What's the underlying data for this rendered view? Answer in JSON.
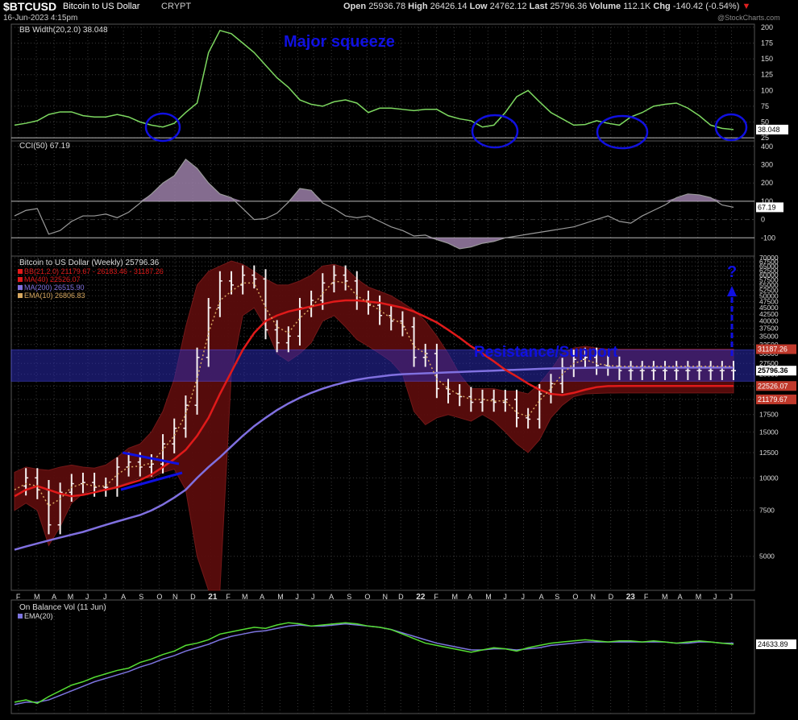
{
  "header": {
    "symbol": "$BTCUSD",
    "name": "Bitcoin to US Dollar",
    "exchange": "CRYPT",
    "datetime": "16-Jun-2023 4:15pm",
    "open_label": "Open",
    "open": "25936.78",
    "high_label": "High",
    "high": "26426.14",
    "low_label": "Low",
    "low": "24762.12",
    "last_label": "Last",
    "last": "25796.36",
    "volume_label": "Volume",
    "volume": "112.1K",
    "chg_label": "Chg",
    "chg": "-140.42 (-0.54%)",
    "arrow": "▼",
    "watermark": "@StockCharts.com"
  },
  "colors": {
    "background": "#000000",
    "grid": "#3a3a3a",
    "bb_width_line": "#7dd860",
    "cci_line": "#9a9a9a",
    "cci_fill": "#9b7fa8",
    "bb_band_fill": "#5a0c0c",
    "ma40": "#e01a1a",
    "ma200": "#8070e0",
    "ema10": "#d8a860",
    "candle": "#f5f0f0",
    "obv": "#55dd33",
    "obv_ema": "#7d75e0",
    "annotation": "#1010e0",
    "band_zone": "#2a2ab0"
  },
  "chart_data": [
    {
      "type": "line",
      "panel": "BB Width",
      "legend": "BB Width(20,2.0) 38.048",
      "annotation": "Major squeeze",
      "last_value_label": "38.048",
      "y_ticks": [
        25,
        50,
        75,
        100,
        125,
        150,
        175,
        200
      ],
      "ylim": [
        20,
        205
      ],
      "x": [
        0,
        3,
        6,
        9,
        12,
        15,
        18,
        21,
        24,
        27,
        30,
        33,
        36,
        39,
        42,
        45,
        48,
        51,
        54,
        57,
        60,
        63,
        66,
        69,
        72,
        75,
        78,
        81,
        84,
        87,
        90,
        93,
        96,
        99,
        102,
        105,
        108,
        111,
        114,
        117,
        120,
        123,
        126,
        129,
        132,
        135,
        138,
        141,
        144,
        147,
        150,
        153,
        156,
        159,
        162,
        165,
        168,
        171,
        174,
        177,
        180,
        183,
        186,
        189
      ],
      "values": [
        45,
        48,
        52,
        62,
        66,
        66,
        60,
        58,
        58,
        62,
        58,
        50,
        45,
        42,
        48,
        65,
        80,
        160,
        195,
        190,
        175,
        160,
        140,
        120,
        105,
        85,
        78,
        75,
        82,
        85,
        80,
        65,
        72,
        72,
        70,
        68,
        70,
        70,
        60,
        55,
        52,
        42,
        45,
        65,
        90,
        100,
        82,
        65,
        55,
        45,
        46,
        52,
        48,
        45,
        58,
        65,
        75,
        78,
        80,
        72,
        60,
        45,
        40,
        38
      ]
    },
    {
      "type": "area",
      "panel": "CCI",
      "legend": "CCI(50) 67.19",
      "last_value_label": "67.19",
      "y_ticks": [
        -100,
        0,
        100,
        200,
        300,
        400
      ],
      "ylim": [
        -200,
        430
      ],
      "x": [
        0,
        3,
        6,
        9,
        12,
        15,
        18,
        21,
        24,
        27,
        30,
        33,
        36,
        39,
        42,
        45,
        48,
        51,
        54,
        57,
        60,
        63,
        66,
        69,
        72,
        75,
        78,
        81,
        84,
        87,
        90,
        93,
        96,
        99,
        102,
        105,
        108,
        111,
        114,
        117,
        120,
        123,
        126,
        129,
        132,
        135,
        138,
        141,
        144,
        147,
        150,
        153,
        156,
        159,
        162,
        165,
        168,
        171,
        174,
        177,
        180,
        183,
        186,
        189
      ],
      "values": [
        20,
        50,
        60,
        -80,
        -60,
        -10,
        20,
        20,
        30,
        10,
        40,
        90,
        140,
        200,
        240,
        330,
        280,
        200,
        140,
        120,
        60,
        0,
        5,
        35,
        95,
        170,
        160,
        90,
        60,
        20,
        10,
        20,
        -10,
        -40,
        -60,
        -90,
        -85,
        -110,
        -130,
        -160,
        -150,
        -130,
        -120,
        -100,
        -90,
        -80,
        -70,
        -60,
        -50,
        -40,
        -20,
        0,
        20,
        -10,
        -20,
        20,
        50,
        80,
        120,
        140,
        135,
        120,
        80,
        67
      ]
    },
    {
      "type": "candlestick",
      "panel": "Price",
      "title": "Bitcoin to US Dollar (Weekly) 25796.36",
      "legend": [
        "BB(21,2.0) 21179.67 - 26183.46 - 31187.26",
        "MA(40) 22526.07",
        "MA(200) 26515.90",
        "EMA(10) 26806.83"
      ],
      "annotations": [
        "Resistance/Support",
        "?"
      ],
      "scale": "log",
      "ylim": [
        3700,
        71000
      ],
      "y_ticks": [
        5000,
        7500,
        10000,
        12500,
        15000,
        17500,
        20000,
        22500,
        25000,
        27500,
        30000,
        32500,
        35000,
        37500,
        40000,
        42500,
        45000,
        47500,
        50000,
        52500,
        55000,
        57500,
        60000,
        62500,
        65000,
        67500,
        70000
      ],
      "price_labels": [
        "31187.26",
        "25796.36",
        "22526.07",
        "21179.67"
      ],
      "support_zone": [
        23500,
        31000
      ],
      "x_labels": [
        "F",
        "M",
        "A",
        "M",
        "J",
        "J",
        "A",
        "S",
        "O",
        "N",
        "D",
        "21",
        "F",
        "M",
        "A",
        "M",
        "J",
        "J",
        "A",
        "S",
        "O",
        "N",
        "D",
        "22",
        "F",
        "M",
        "A",
        "M",
        "J",
        "J",
        "A",
        "S",
        "O",
        "N",
        "D",
        "23",
        "F",
        "M",
        "A",
        "M",
        "J",
        "J"
      ],
      "x_label_positions": [
        1,
        5.5,
        10,
        14,
        18.5,
        23,
        27.5,
        32,
        36.5,
        40.5,
        45,
        49.5,
        54,
        58,
        62.5,
        67,
        71.5,
        75.5,
        80,
        84.5,
        89,
        93.5,
        97.5,
        102,
        106.5,
        111,
        115,
        119.5,
        124,
        128.5,
        133,
        137,
        141.5,
        146,
        150.5,
        155,
        159.5,
        164,
        168,
        172.5,
        177,
        181
      ],
      "x": [
        0,
        3,
        6,
        9,
        12,
        15,
        18,
        21,
        24,
        27,
        30,
        33,
        36,
        39,
        42,
        45,
        48,
        51,
        54,
        57,
        60,
        63,
        66,
        69,
        72,
        75,
        78,
        81,
        84,
        87,
        90,
        93,
        96,
        99,
        102,
        105,
        108,
        111,
        114,
        117,
        120,
        123,
        126,
        129,
        132,
        135,
        138,
        141,
        144,
        147,
        150,
        153,
        156,
        159,
        162,
        165,
        168,
        171,
        174,
        177,
        180,
        183,
        186,
        189
      ],
      "close": [
        9300,
        10000,
        9000,
        6600,
        8800,
        9500,
        9600,
        9200,
        9200,
        11000,
        11500,
        11000,
        11300,
        13500,
        15500,
        19000,
        29000,
        45000,
        57000,
        55000,
        60000,
        58000,
        37000,
        33000,
        35000,
        45000,
        48000,
        56000,
        60000,
        57000,
        48000,
        46000,
        42000,
        40000,
        38000,
        29000,
        30000,
        22000,
        21000,
        20500,
        19500,
        20000,
        19500,
        20000,
        17000,
        16800,
        21000,
        23000,
        26500,
        28500,
        29000,
        27000,
        26800,
        25796,
        25796,
        25796,
        25796,
        25796,
        25796,
        25796,
        25796,
        25796,
        25796,
        25796
      ],
      "bb_upper": [
        10500,
        11000,
        10800,
        10700,
        11000,
        11200,
        11000,
        10900,
        11200,
        12000,
        13000,
        13500,
        15000,
        18000,
        24000,
        38000,
        55000,
        62000,
        65000,
        68000,
        66000,
        62000,
        58000,
        55000,
        55000,
        57000,
        60000,
        65000,
        66000,
        64000,
        58000,
        54000,
        52000,
        50000,
        47000,
        44000,
        40000,
        35000,
        30000,
        25000,
        22000,
        22000,
        22000,
        21500,
        21500,
        21000,
        23000,
        26000,
        30000,
        31500,
        32000,
        31500,
        31200,
        31187,
        31187,
        31187,
        31187,
        31187,
        31187,
        31187,
        31187,
        31187,
        31187,
        31187
      ],
      "bb_lower": [
        7500,
        8000,
        7500,
        5500,
        6500,
        8000,
        8700,
        9000,
        9000,
        9300,
        9600,
        10000,
        10000,
        10500,
        10800,
        9000,
        5000,
        3700,
        3700,
        25000,
        42000,
        45000,
        38000,
        30000,
        28000,
        30000,
        33000,
        40000,
        42000,
        38000,
        34000,
        32000,
        30000,
        28000,
        25000,
        18000,
        16000,
        17000,
        17500,
        17000,
        16500,
        17500,
        16500,
        15000,
        13500,
        12500,
        14000,
        17000,
        19000,
        20500,
        21000,
        21100,
        21170,
        21179,
        21179,
        21179,
        21179,
        21179,
        21179,
        21179,
        21179,
        21179,
        21179,
        21179
      ],
      "ma40": [
        8500,
        9000,
        9300,
        9000,
        8700,
        8500,
        8600,
        8800,
        9000,
        9200,
        9500,
        9800,
        10300,
        11000,
        11800,
        12800,
        14500,
        17000,
        21000,
        25500,
        31000,
        36000,
        40000,
        42000,
        43500,
        44500,
        45500,
        46500,
        47500,
        48000,
        48000,
        47500,
        47000,
        46000,
        45000,
        43500,
        41500,
        39500,
        37000,
        34500,
        32000,
        30000,
        28000,
        26000,
        24500,
        23000,
        21800,
        21000,
        20800,
        21200,
        21800,
        22300,
        22500,
        22526,
        22526,
        22526,
        22526,
        22526,
        22526,
        22526,
        22526,
        22526,
        22526,
        22526
      ],
      "ma200": [
        5300,
        5450,
        5600,
        5750,
        5900,
        6050,
        6200,
        6400,
        6600,
        6800,
        7000,
        7200,
        7500,
        7900,
        8400,
        9000,
        10000,
        11000,
        12000,
        13200,
        14500,
        15800,
        17000,
        18200,
        19300,
        20300,
        21200,
        22000,
        22700,
        23300,
        23800,
        24200,
        24500,
        24800,
        25000,
        25100,
        25200,
        25300,
        25400,
        25500,
        25600,
        25700,
        25800,
        25900,
        26000,
        26100,
        26200,
        26300,
        26350,
        26400,
        26450,
        26480,
        26500,
        26515,
        26515,
        26515,
        26515,
        26515,
        26515,
        26515,
        26515,
        26515,
        26515,
        26515
      ],
      "ema10": [
        9000,
        9500,
        9300,
        7800,
        8300,
        9200,
        9500,
        9300,
        9300,
        10300,
        11000,
        11100,
        11400,
        12800,
        14500,
        17500,
        24000,
        36000,
        48000,
        52000,
        56000,
        56000,
        45000,
        38000,
        36000,
        41000,
        45000,
        51000,
        57000,
        56000,
        50000,
        47000,
        44000,
        41000,
        39000,
        32000,
        30000,
        24000,
        22000,
        20800,
        20000,
        20000,
        19700,
        19800,
        17800,
        17200,
        19800,
        22000,
        25000,
        27500,
        28400,
        27500,
        27000,
        26806,
        26806,
        26806,
        26806,
        26806,
        26806,
        26806,
        26806,
        26806,
        26806,
        26806
      ]
    },
    {
      "type": "line",
      "panel": "On Balance Volume",
      "legend": [
        "On Balance Vol (11 Jun)",
        "EMA(20)"
      ],
      "last_value_label": "24633.89",
      "x": [
        0,
        3,
        6,
        9,
        12,
        15,
        18,
        21,
        24,
        27,
        30,
        33,
        36,
        39,
        42,
        45,
        48,
        51,
        54,
        57,
        60,
        63,
        66,
        69,
        72,
        75,
        78,
        81,
        84,
        87,
        90,
        93,
        96,
        99,
        102,
        105,
        108,
        111,
        114,
        117,
        120,
        123,
        126,
        129,
        132,
        135,
        138,
        141,
        144,
        147,
        150,
        153,
        156,
        159,
        162,
        165,
        168,
        171,
        174,
        177,
        180,
        183,
        186,
        189
      ],
      "values": [
        10,
        12,
        9,
        15,
        20,
        25,
        28,
        32,
        35,
        38,
        40,
        45,
        48,
        52,
        55,
        60,
        62,
        65,
        70,
        72,
        74,
        76,
        75,
        78,
        80,
        79,
        77,
        78,
        79,
        80,
        79,
        77,
        76,
        74,
        70,
        66,
        62,
        60,
        58,
        56,
        54,
        56,
        58,
        57,
        55,
        58,
        60,
        62,
        63,
        64,
        65,
        64,
        63,
        64,
        64,
        63,
        64,
        63,
        62,
        63,
        64,
        63,
        62,
        61
      ],
      "ema": [
        8,
        10,
        10,
        12,
        16,
        20,
        24,
        28,
        31,
        34,
        37,
        41,
        44,
        48,
        51,
        55,
        58,
        61,
        65,
        68,
        70,
        72,
        73,
        75,
        77,
        78,
        77,
        77,
        78,
        79,
        78,
        77,
        76,
        74,
        71,
        68,
        65,
        62,
        60,
        58,
        56,
        56,
        57,
        57,
        56,
        57,
        58,
        60,
        61,
        62,
        63,
        63,
        63,
        63,
        63,
        63,
        63,
        63,
        62,
        62,
        63,
        63,
        62,
        62
      ]
    }
  ]
}
